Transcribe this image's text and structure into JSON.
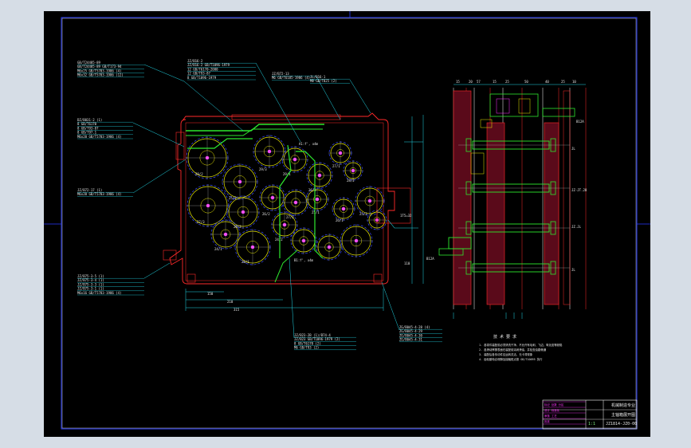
{
  "drawing": {
    "colors": {
      "background": "#000000",
      "frame": "#2a3cff",
      "body": "#ff2a2a",
      "leader": "#22d8e8",
      "gear": "#e8e800",
      "pitch": "#3a4cff",
      "shaft": "#2ee82e",
      "magenta": "#ff33ff",
      "text": "#e8e8e8",
      "page": "#d6dde6"
    },
    "left_callouts": [
      {
        "lines": [
          "GB/T24485-89",
          "GB/T24485-89 GB/T173-94",
          "M6x25 GB/T5783-1986 (4)",
          "M6x32 GB/T5783-1986 (12)"
        ]
      },
      {
        "lines": [
          "DZ/B031-2 (1)",
          "8 GB/T6170",
          "8 GB/T93-87",
          "8 GB/T97.1",
          "M6x20 GB/T5783-1986 (4)"
        ]
      },
      {
        "lines": [
          "JZ/B72-17 (1)",
          "M6x20 GB/T5783-1986 (4)"
        ]
      },
      {
        "lines": [
          "JZ/B75-3-5 (1)",
          "JZ/B75-3-4 (1)",
          "JZ/B75-3-3 (1)",
          "JZ/B75-3-1 (1)",
          "M6x16 GB/T5783-1986 (4)"
        ]
      }
    ],
    "top_callouts": [
      {
        "lines": [
          "JZ/B16-2",
          "JZ/B16-2 GB/T1096-1979",
          "12 GB/T6170-2000",
          "12 GB/T93-87",
          "8 GB/T1096-1979"
        ]
      },
      {
        "lines": [
          "JZ/B72-13",
          "M6 GB/T6185-1986 (4)"
        ]
      },
      {
        "lines": [
          "JL/B16-1",
          "M8 GB/T825 (2)"
        ]
      }
    ],
    "bottom_callouts": [
      {
        "lines": [
          "JZ/B23-2B (1)/B74-4",
          "JZ/B23 GB/T1096-1979 (2)",
          "8 GB/T6170 (2)",
          "M6 GB/T93 (2)"
        ]
      },
      {
        "lines": [
          "ZG/B045-4-28 (4)",
          "ZG/B045-4-29",
          "ZG/B045-4-30",
          "ZG/B045-4-31"
        ]
      }
    ],
    "gear_labels": [
      "29/2",
      "25/3",
      "29/3",
      "29/1",
      "26/3",
      "27/1",
      "28/2",
      "27/3",
      "28/3",
      "26/2",
      "27/2",
      "25/1",
      "26/1",
      "25/2",
      "24/1",
      "28/1",
      "24/2"
    ],
    "dimension_labels": [
      "A1:f', x4m",
      "150",
      "210",
      "315",
      "1T5=32",
      "110",
      "B1:f', x4m"
    ],
    "section_dims": [
      "15",
      "20",
      "57",
      "15",
      "25",
      "50",
      "40",
      "25",
      "10"
    ],
    "section_labels": [
      "JL",
      "JZ-JT.28",
      "JZ.JL",
      "JL",
      "B12A",
      "B12A"
    ],
    "tech_req_title": "技 术 要 求",
    "tech_requirements": [
      "1. 各零件装配前必须清洗干净，不允许有毛刺、飞边、氧化皮等缺陷",
      "2. 各滑动摩擦表面在装配前涂润滑油，并检查油路畅通",
      "3. 装配后各传动件应运转灵活，无卡滞现象",
      "4. 齿轮副啮合侧隙及接触斑点按 GB/T10095 执行"
    ],
    "title_block": {
      "drawing_name": "主轴箱展开图",
      "school": "机械制造专业",
      "scale": "1:1",
      "drawing_no": "JZ1814-JZ0-00",
      "rev_rows": [
        "标记 处数 分区",
        "设计 标准化",
        "审核 工艺",
        "批准"
      ]
    }
  }
}
